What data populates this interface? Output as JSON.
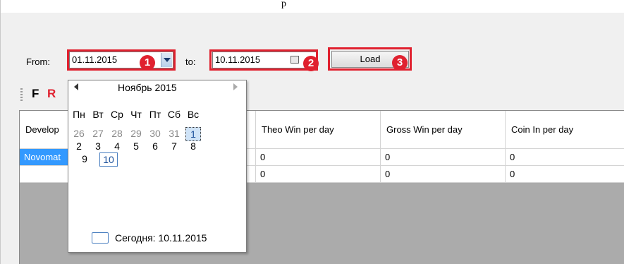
{
  "partial_title": "p",
  "filter": {
    "from_label": "From:",
    "from_value": "01.11.2015",
    "to_label": "to:",
    "to_value": "10.11.2015",
    "load_label": "Load"
  },
  "badges": [
    "1",
    "2",
    "3"
  ],
  "toolbar": {
    "f_label": "F",
    "r_label": "R"
  },
  "grid": {
    "headers": [
      "Develop",
      "",
      "Theo Win per day",
      "Gross Win per day",
      "Coin In per day"
    ],
    "rows": [
      [
        "Novomat",
        "",
        "0",
        "0",
        "0"
      ],
      [
        "",
        "",
        "0",
        "0",
        "0"
      ]
    ]
  },
  "calendar": {
    "month_title": "Ноябрь 2015",
    "weekdays": [
      "Пн",
      "Вт",
      "Ср",
      "Чт",
      "Пт",
      "Сб",
      "Вс"
    ],
    "week1": [
      "26",
      "27",
      "28",
      "29",
      "30",
      "31",
      "1"
    ],
    "week2": [
      "2",
      "3",
      "4",
      "5",
      "6",
      "7",
      "8"
    ],
    "week3": [
      "9",
      "10"
    ],
    "today_label": "Сегодня: 10.11.2015"
  },
  "colors": {
    "highlight": "#e0212f",
    "selection": "#3399ff"
  }
}
